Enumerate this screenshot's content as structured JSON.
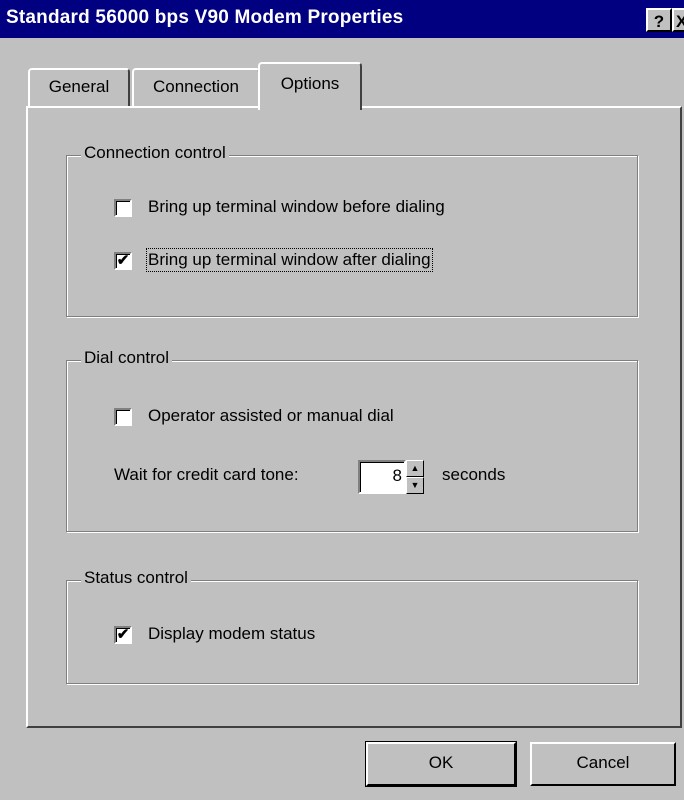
{
  "window": {
    "title": "Standard 56000 bps V90 Modem Properties",
    "help_button": "?",
    "close_button": "X"
  },
  "tabs": [
    {
      "label": "General"
    },
    {
      "label": "Connection"
    },
    {
      "label": "Options",
      "selected": true
    }
  ],
  "connection_control": {
    "legend": "Connection control",
    "before_dialing": {
      "label": "Bring up terminal window before dialing",
      "checked": false
    },
    "after_dialing": {
      "label": "Bring up terminal window after dialing",
      "checked": true
    }
  },
  "dial_control": {
    "legend": "Dial control",
    "manual_dial": {
      "label": "Operator assisted or manual dial",
      "checked": false
    },
    "wait_label": "Wait for credit card tone:",
    "wait_value": "8",
    "seconds_label": "seconds"
  },
  "status_control": {
    "legend": "Status control",
    "display_status": {
      "label": "Display modem status",
      "checked": true
    }
  },
  "buttons": {
    "ok": "OK",
    "cancel": "Cancel"
  },
  "glyphs": {
    "check": "✔",
    "up": "▲",
    "down": "▼"
  },
  "colors": {
    "titlebar": "#000080",
    "face": "#c0c0c0"
  }
}
